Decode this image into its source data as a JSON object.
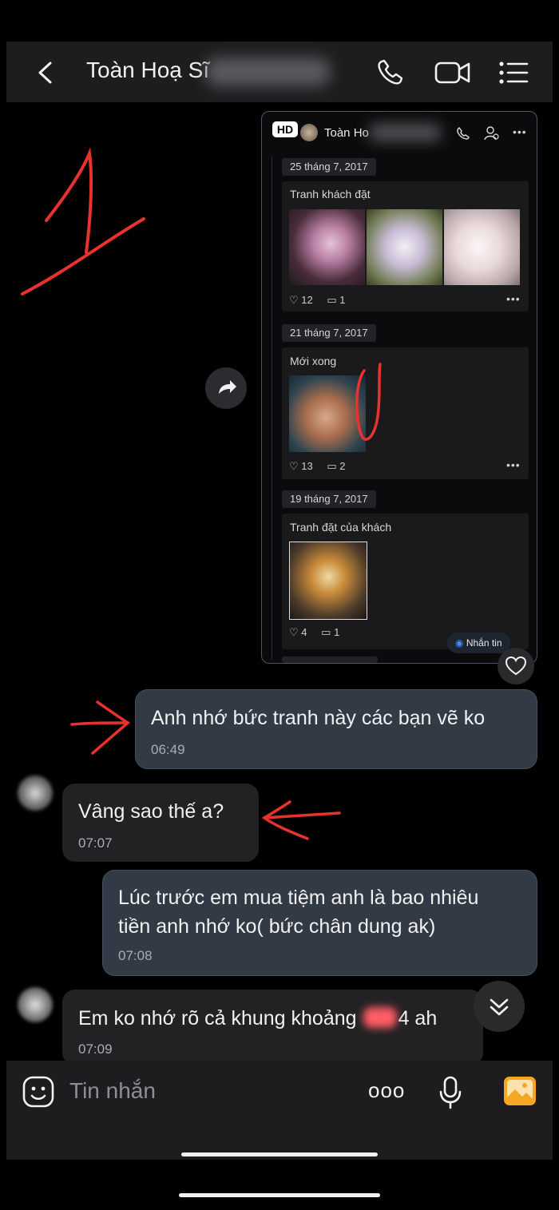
{
  "header": {
    "title": "Toàn Hoạ Sĩ",
    "icons": [
      "back-chevron-icon",
      "phone-icon",
      "video-camera-icon",
      "list-menu-icon"
    ]
  },
  "shared_screenshot": {
    "hd_badge": "HD",
    "profile_name": "Toàn Ho",
    "posts": [
      {
        "date": "25 tháng 7, 2017",
        "caption": "Tranh khách đặt",
        "likes": "12",
        "comments": "1"
      },
      {
        "date": "21 tháng 7, 2017",
        "caption": "Mới xong",
        "likes": "13",
        "comments": "2"
      },
      {
        "date": "19 tháng 7, 2017",
        "caption": "Tranh đặt của khách",
        "likes": "4",
        "comments": "1"
      }
    ],
    "message_chip": "Nhắn tin",
    "more": "•••"
  },
  "messages": [
    {
      "direction": "out",
      "text": "Anh nhớ bức tranh này các bạn vẽ ko",
      "time": "06:49"
    },
    {
      "direction": "in",
      "text": "Vâng sao thế a?",
      "time": "07:07"
    },
    {
      "direction": "out",
      "line1": "Lúc trước em mua tiệm anh là bao nhiêu",
      "line2": "tiền anh nhớ ko( bức chân dung ak)",
      "time": "07:08"
    },
    {
      "direction": "in",
      "text_before": "Em ko nhớ rõ cả khung khoảng",
      "text_after": "4 ah",
      "time": "07:09"
    }
  ],
  "annotation": {
    "number": "1",
    "color": "#e8322d"
  },
  "input": {
    "placeholder": "Tin nhắn",
    "more": "ooo"
  },
  "colors": {
    "accent_orange": "#f5a623",
    "bubble_out": "#323a46",
    "bubble_in": "#222224",
    "red_markup": "#e8322d"
  }
}
